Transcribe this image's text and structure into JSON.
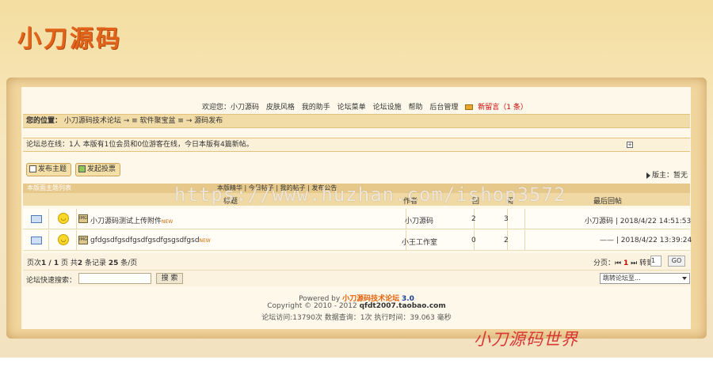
{
  "header": {
    "logo_text": "小刀源码"
  },
  "topnav": {
    "items": [
      "欢迎您：小刀源码",
      "皮肤风格",
      "我的助手",
      "论坛菜单",
      "论坛设施",
      "帮助",
      "后台管理"
    ],
    "message_label": "新留言（1 条）"
  },
  "location": {
    "prefix": "您的位置：",
    "path": "小刀源码技术论坛 → ≡ 软件聚宝盆 ≡ → 源码发布"
  },
  "online": {
    "text": "论坛总在线：1人 本版有1位会员和0位游客在线，今日本版有4篇新帖。",
    "expand": "+"
  },
  "actions": {
    "post_topic": "发布主题",
    "post_poll": "发起投票"
  },
  "moderator": {
    "label": "版主：暂无"
  },
  "thread_list": {
    "title": "本版面主题列表",
    "filters": "本版精华 | 今日帖子 | 我的帖子 | 发布公告",
    "columns": {
      "title": "标题",
      "author": "作者",
      "replies": "回",
      "views": "阅",
      "last_reply": "最后回帖"
    },
    "rows": [
      {
        "title": "小刀源码测试上传附件",
        "badge": "NEW",
        "tag": "IMG",
        "author": "小刀源码",
        "replies": "2",
        "views": "3",
        "last_reply": "小刀源码 | 2018/4/22 14:51:53"
      },
      {
        "title": "gfdgsdfgsdfgsdfgsdfgsgsdfgsd",
        "badge": "NEW",
        "tag": "IMG",
        "author": "小王工作室",
        "replies": "0",
        "views": "2",
        "last_reply": "—— | 2018/4/22 13:39:24"
      }
    ]
  },
  "pager": {
    "info_prefix": "页次",
    "info_page": "1 / 1",
    "info_mid": " 页 共",
    "info_total": "2",
    "info_mid2": " 条记录 ",
    "info_per": "25",
    "info_suffix": " 条/页",
    "right_label": "分页：",
    "current": "1",
    "goto_label": "转到",
    "goto_value": "1",
    "go": "GO"
  },
  "search": {
    "label": "论坛快速搜索：",
    "button": "搜 索",
    "jump_placeholder": "跳转论坛至..."
  },
  "footer": {
    "powered_prefix": "Powered by ",
    "powered_name": "小刀源码技术论坛",
    "version": "3.0",
    "copyright_prefix": "Copyright © 2010 - 2012 ",
    "copyright_site": "qfdt2007.taobao.com",
    "stats": "论坛访问:13790次 数据查询：1次 执行时间：39.063 毫秒"
  },
  "brand_bottom": "小刀源码世界",
  "watermark": "https://www.huzhan.com/ishop3572",
  "colors": {
    "accent_orange": "#e2641a",
    "link_red": "#cc0000",
    "frame": "#f1d69e",
    "brand_red": "#d83535"
  }
}
